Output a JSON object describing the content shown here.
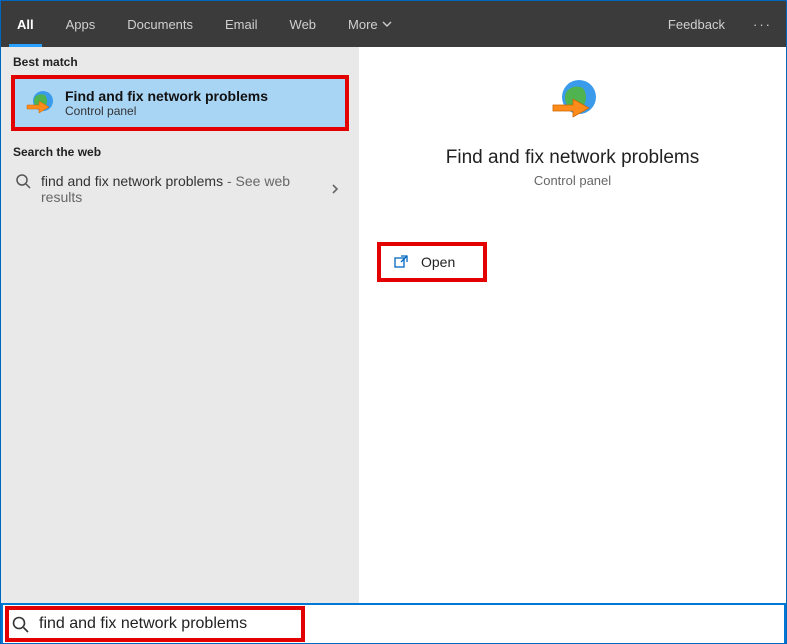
{
  "tabbar": {
    "tabs": [
      "All",
      "Apps",
      "Documents",
      "Email",
      "Web",
      "More"
    ],
    "active_index": 0,
    "feedback": "Feedback"
  },
  "left": {
    "best_match_header": "Best match",
    "best_match": {
      "title": "Find and fix network problems",
      "subtitle": "Control panel"
    },
    "search_web_header": "Search the web",
    "web_result": {
      "query": "find and fix network problems",
      "suffix": " - See web results"
    }
  },
  "right": {
    "title": "Find and fix network problems",
    "subtitle": "Control panel",
    "open_label": "Open"
  },
  "search": {
    "value": "find and fix network problems"
  }
}
